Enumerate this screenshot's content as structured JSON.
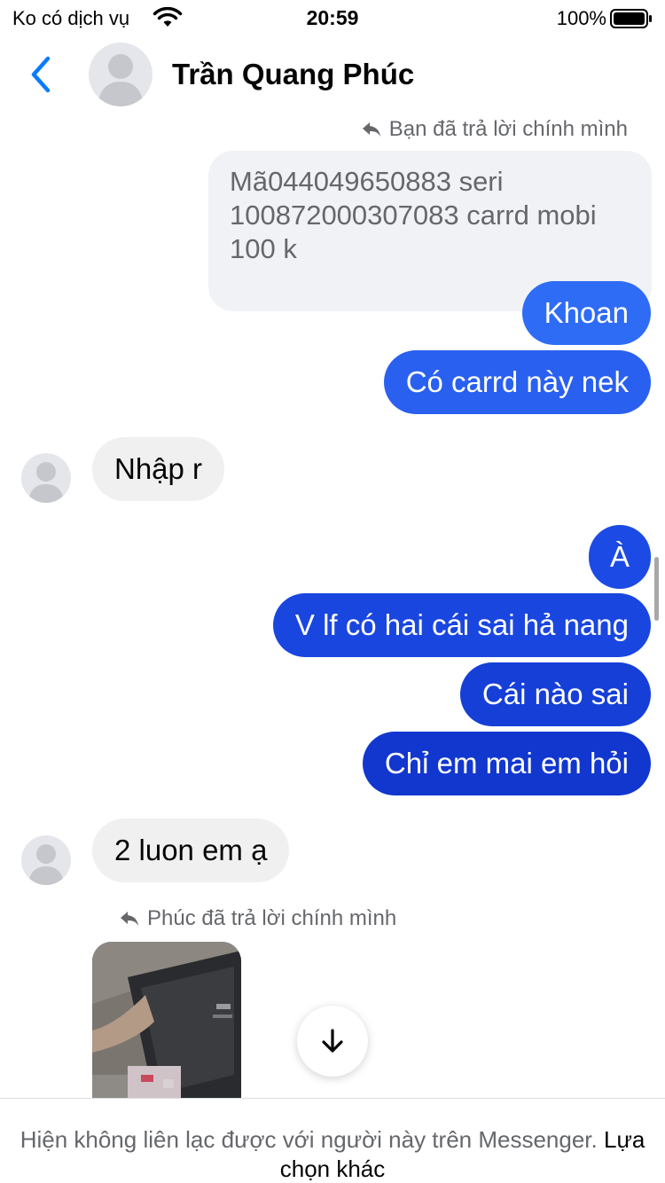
{
  "status_bar": {
    "carrier": "Ko có dịch vụ",
    "time": "20:59",
    "battery": "100%"
  },
  "header": {
    "contact_name": "Trần Quang Phúc",
    "accent_color": "#0a7cff"
  },
  "messages": [
    {
      "kind": "reply_note",
      "text": "Bạn đã trả lời chính mình"
    },
    {
      "kind": "quoted",
      "text": "Mã044049650883 seri 100872000307083 carrd mobi 100 k"
    },
    {
      "kind": "outgoing",
      "text": "Khoan",
      "color": "#2e6cf6"
    },
    {
      "kind": "outgoing",
      "text": "Có carrd này nek",
      "color": "#2a60f0"
    },
    {
      "kind": "incoming",
      "text": "Nhập r"
    },
    {
      "kind": "outgoing",
      "text": "À",
      "color": "#1c4ae4"
    },
    {
      "kind": "outgoing",
      "text": "V lf có hai cái sai hả nang",
      "color": "#1a46e0"
    },
    {
      "kind": "outgoing",
      "text": "Cái nào sai",
      "color": "#163fd8"
    },
    {
      "kind": "outgoing",
      "text": "Chỉ em mai em hỏi",
      "color": "#1237cf"
    },
    {
      "kind": "incoming",
      "text": "2 luon em ạ"
    },
    {
      "kind": "reply_note",
      "text": "Phúc đã trả lời chính mình"
    }
  ],
  "footer": {
    "notice": "Hiện không liên lạc được với người này trên Messenger.",
    "link": "Lựa chọn khác"
  }
}
